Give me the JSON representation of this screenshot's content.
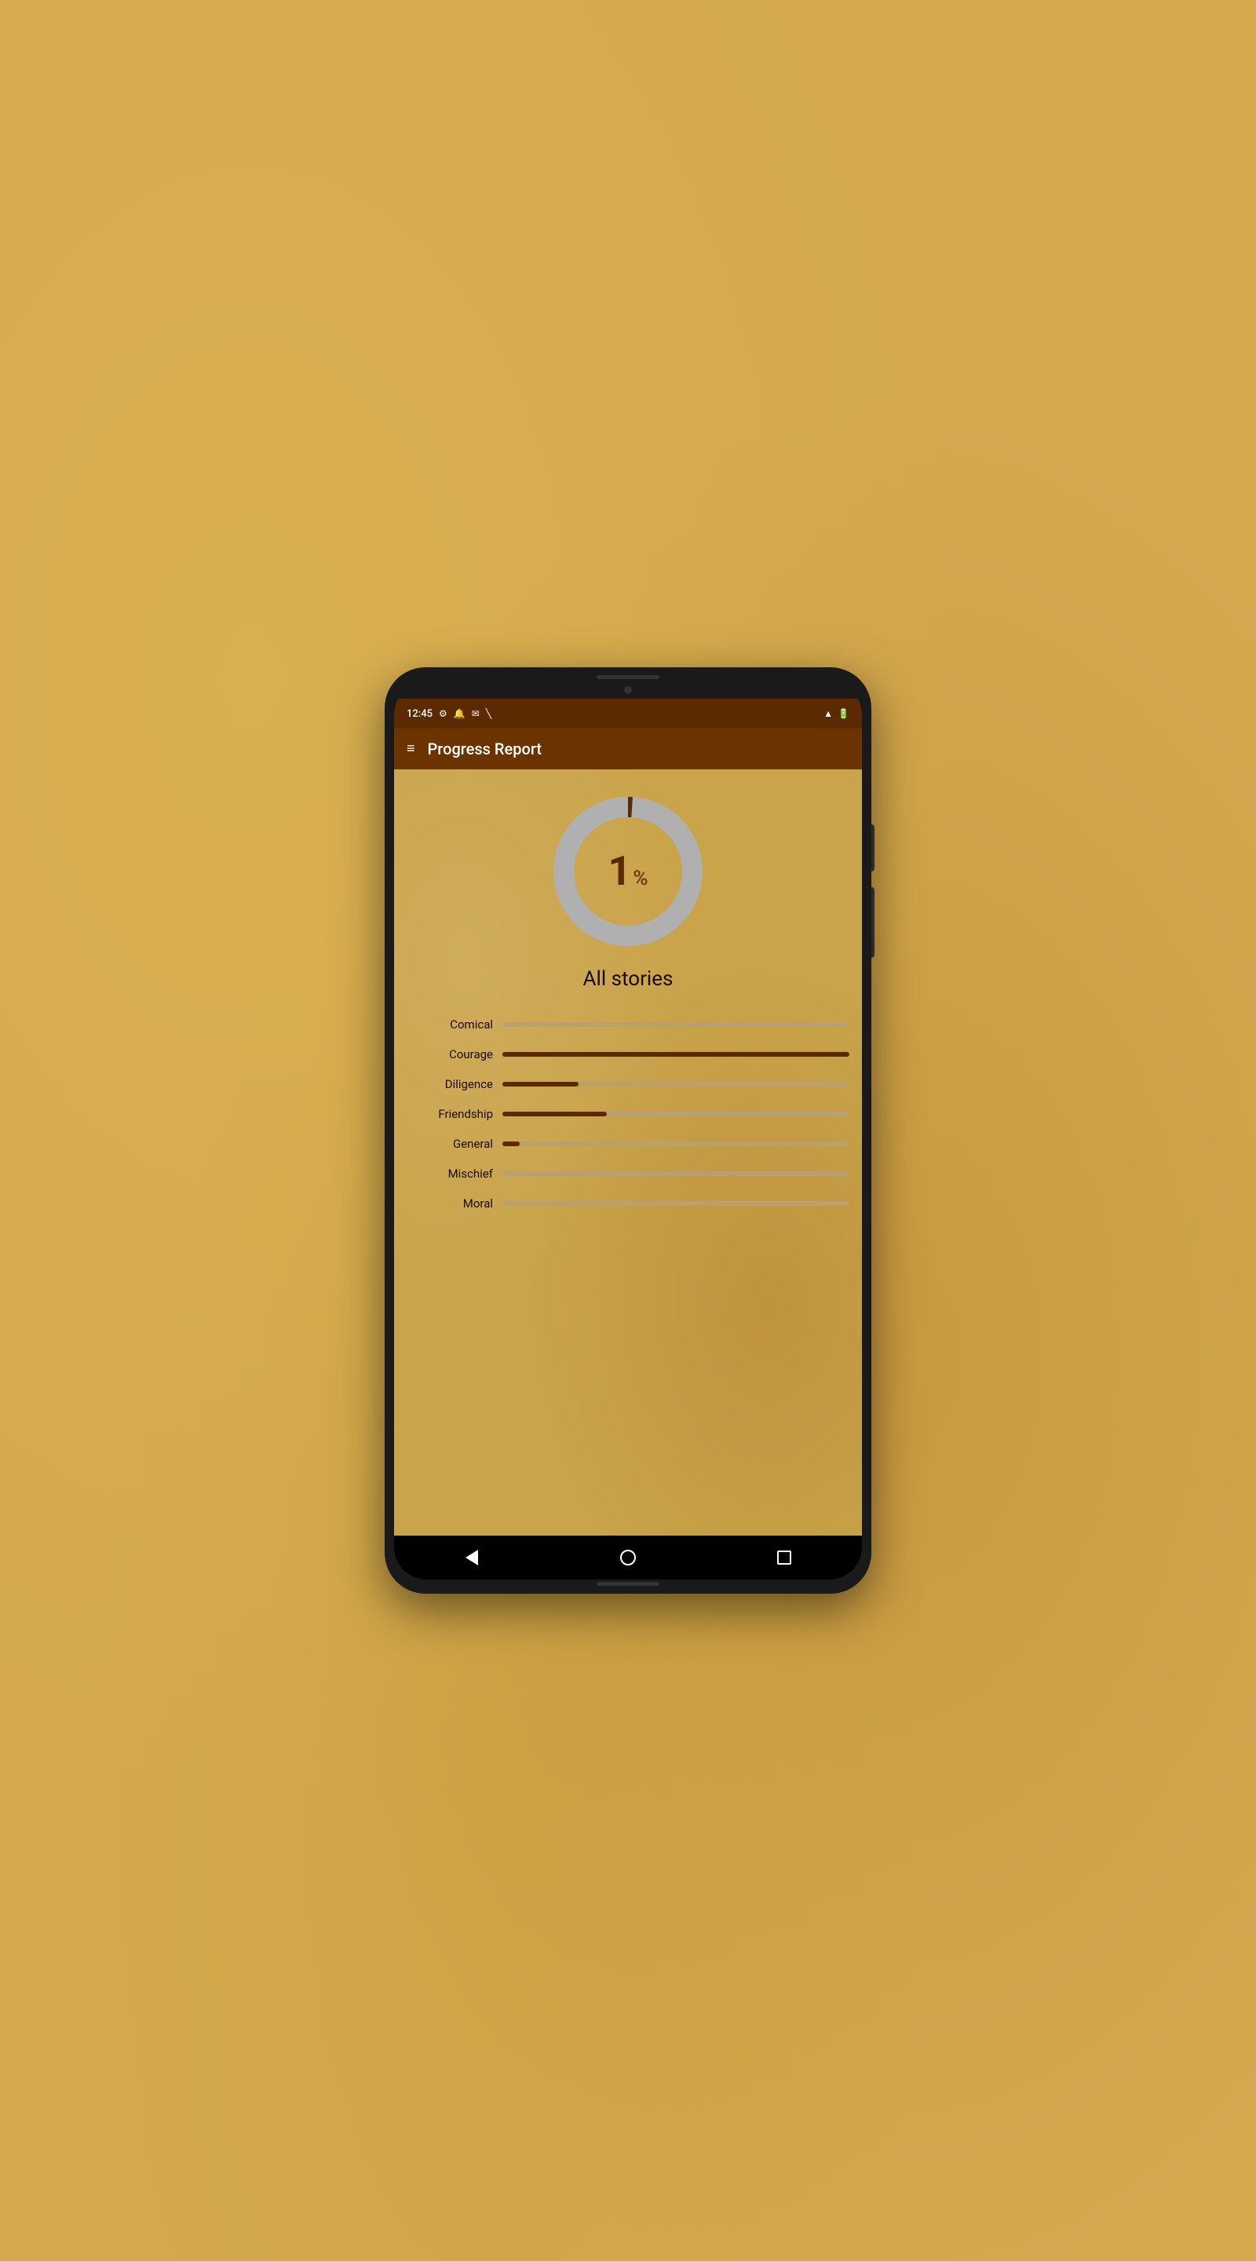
{
  "status_bar": {
    "time": "12:45",
    "icons": [
      "settings",
      "bell",
      "mail",
      "signal-off",
      "signal",
      "battery"
    ]
  },
  "app_bar": {
    "menu_icon": "≡",
    "title": "Progress Report"
  },
  "donut": {
    "percentage": "1",
    "percent_sign": "%",
    "value": 1,
    "track_color": "#b0b0b0",
    "fill_color": "#5c2a00"
  },
  "section_label": "All stories",
  "categories": [
    {
      "name": "Comical",
      "progress": 0,
      "fill_width": "0%"
    },
    {
      "name": "Courage",
      "progress": 100,
      "fill_width": "100%"
    },
    {
      "name": "Diligence",
      "progress": 22,
      "fill_width": "22%"
    },
    {
      "name": "Friendship",
      "progress": 30,
      "fill_width": "30%"
    },
    {
      "name": "General",
      "progress": 5,
      "fill_width": "5%"
    },
    {
      "name": "Mischief",
      "progress": 0,
      "fill_width": "0%"
    },
    {
      "name": "Moral",
      "progress": 0,
      "fill_width": "0%"
    }
  ],
  "nav": {
    "back_label": "back",
    "home_label": "home",
    "recents_label": "recents"
  }
}
